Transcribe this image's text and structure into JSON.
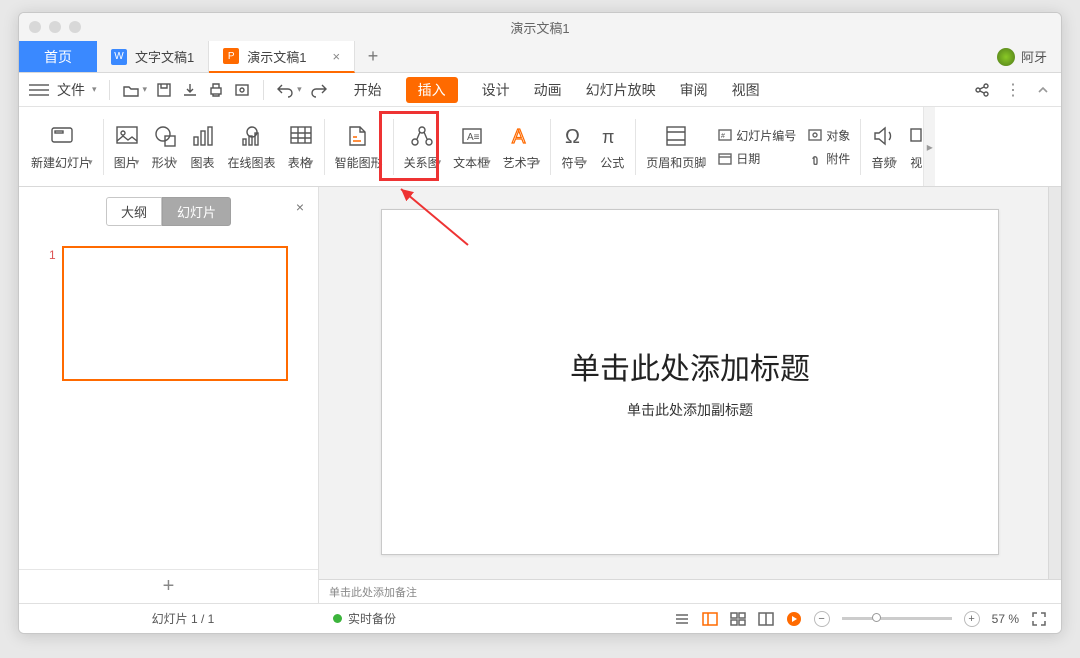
{
  "window": {
    "title": "演示文稿1"
  },
  "tabs": {
    "home": "首页",
    "doc1": "文字文稿1",
    "doc2": "演示文稿1",
    "user": "阿牙"
  },
  "quick": {
    "file": "文件"
  },
  "menu": {
    "items": [
      "开始",
      "插入",
      "设计",
      "动画",
      "幻灯片放映",
      "审阅",
      "视图"
    ],
    "active_index": 1
  },
  "ribbon": {
    "new_slide": "新建幻灯片",
    "picture": "图片",
    "shape": "形状",
    "chart": "图表",
    "online_chart": "在线图表",
    "table": "表格",
    "smartart": "智能图形",
    "relation": "关系图",
    "textbox": "文本框",
    "wordart": "艺术字",
    "symbol": "符号",
    "equation": "公式",
    "header_footer": "页眉和页脚",
    "slide_number": "幻灯片编号",
    "object": "对象",
    "date": "日期",
    "attachment": "附件",
    "audio": "音频",
    "video_trunc": "视"
  },
  "sidepanel": {
    "tab_outline": "大纲",
    "tab_slides": "幻灯片",
    "thumb_num": "1"
  },
  "slide": {
    "title_placeholder": "单击此处添加标题",
    "subtitle_placeholder": "单击此处添加副标题"
  },
  "notes": {
    "placeholder": "单击此处添加备注"
  },
  "status": {
    "slide_counter": "幻灯片 1 / 1",
    "backup": "实时备份",
    "zoom_pct": "57 %"
  }
}
